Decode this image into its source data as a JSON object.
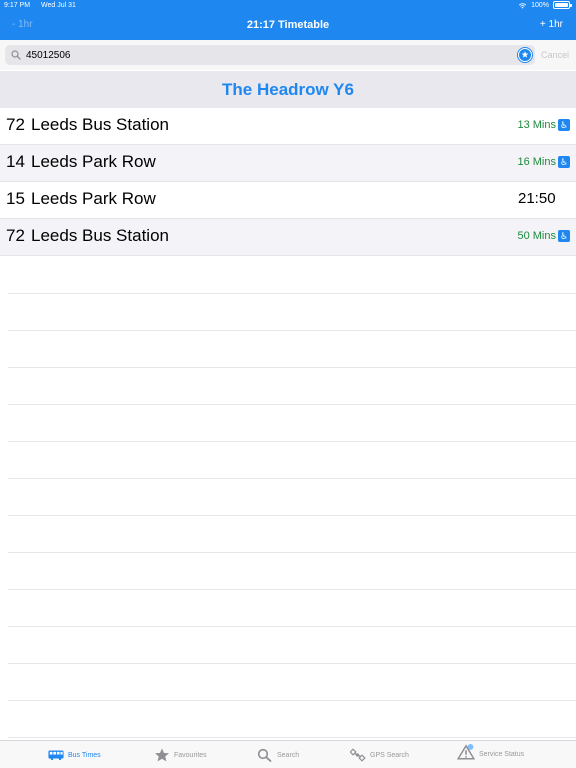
{
  "status_bar": {
    "time": "9:17 PM",
    "date": "Wed Jul 31",
    "battery": "100%"
  },
  "nav": {
    "left": "- 1hr",
    "title": "21:17 Timetable",
    "right": "+ 1hr"
  },
  "search": {
    "value": "45012506",
    "cancel": "Cancel"
  },
  "stop": {
    "name": "The Headrow Y6"
  },
  "departures": [
    {
      "route": "72",
      "destination": "Leeds Bus Station",
      "due": "13 Mins",
      "accessible": true
    },
    {
      "route": "14",
      "destination": "Leeds Park Row",
      "due": "16 Mins",
      "accessible": true
    },
    {
      "route": "15",
      "destination": "Leeds Park Row",
      "due": "21:50",
      "accessible": false
    },
    {
      "route": "72",
      "destination": "Leeds Bus Station",
      "due": "50 Mins",
      "accessible": true
    }
  ],
  "tabs": [
    {
      "label": "Bus Times",
      "icon": "bus-icon",
      "active": true
    },
    {
      "label": "Favourites",
      "icon": "star-icon",
      "active": false
    },
    {
      "label": "Search",
      "icon": "search-icon",
      "active": false
    },
    {
      "label": "GPS Search",
      "icon": "satellite-icon",
      "active": false
    },
    {
      "label": "Service Status",
      "icon": "warning-icon",
      "active": false
    }
  ],
  "colors": {
    "accent": "#1e87f0",
    "due": "#1e8a3c"
  }
}
